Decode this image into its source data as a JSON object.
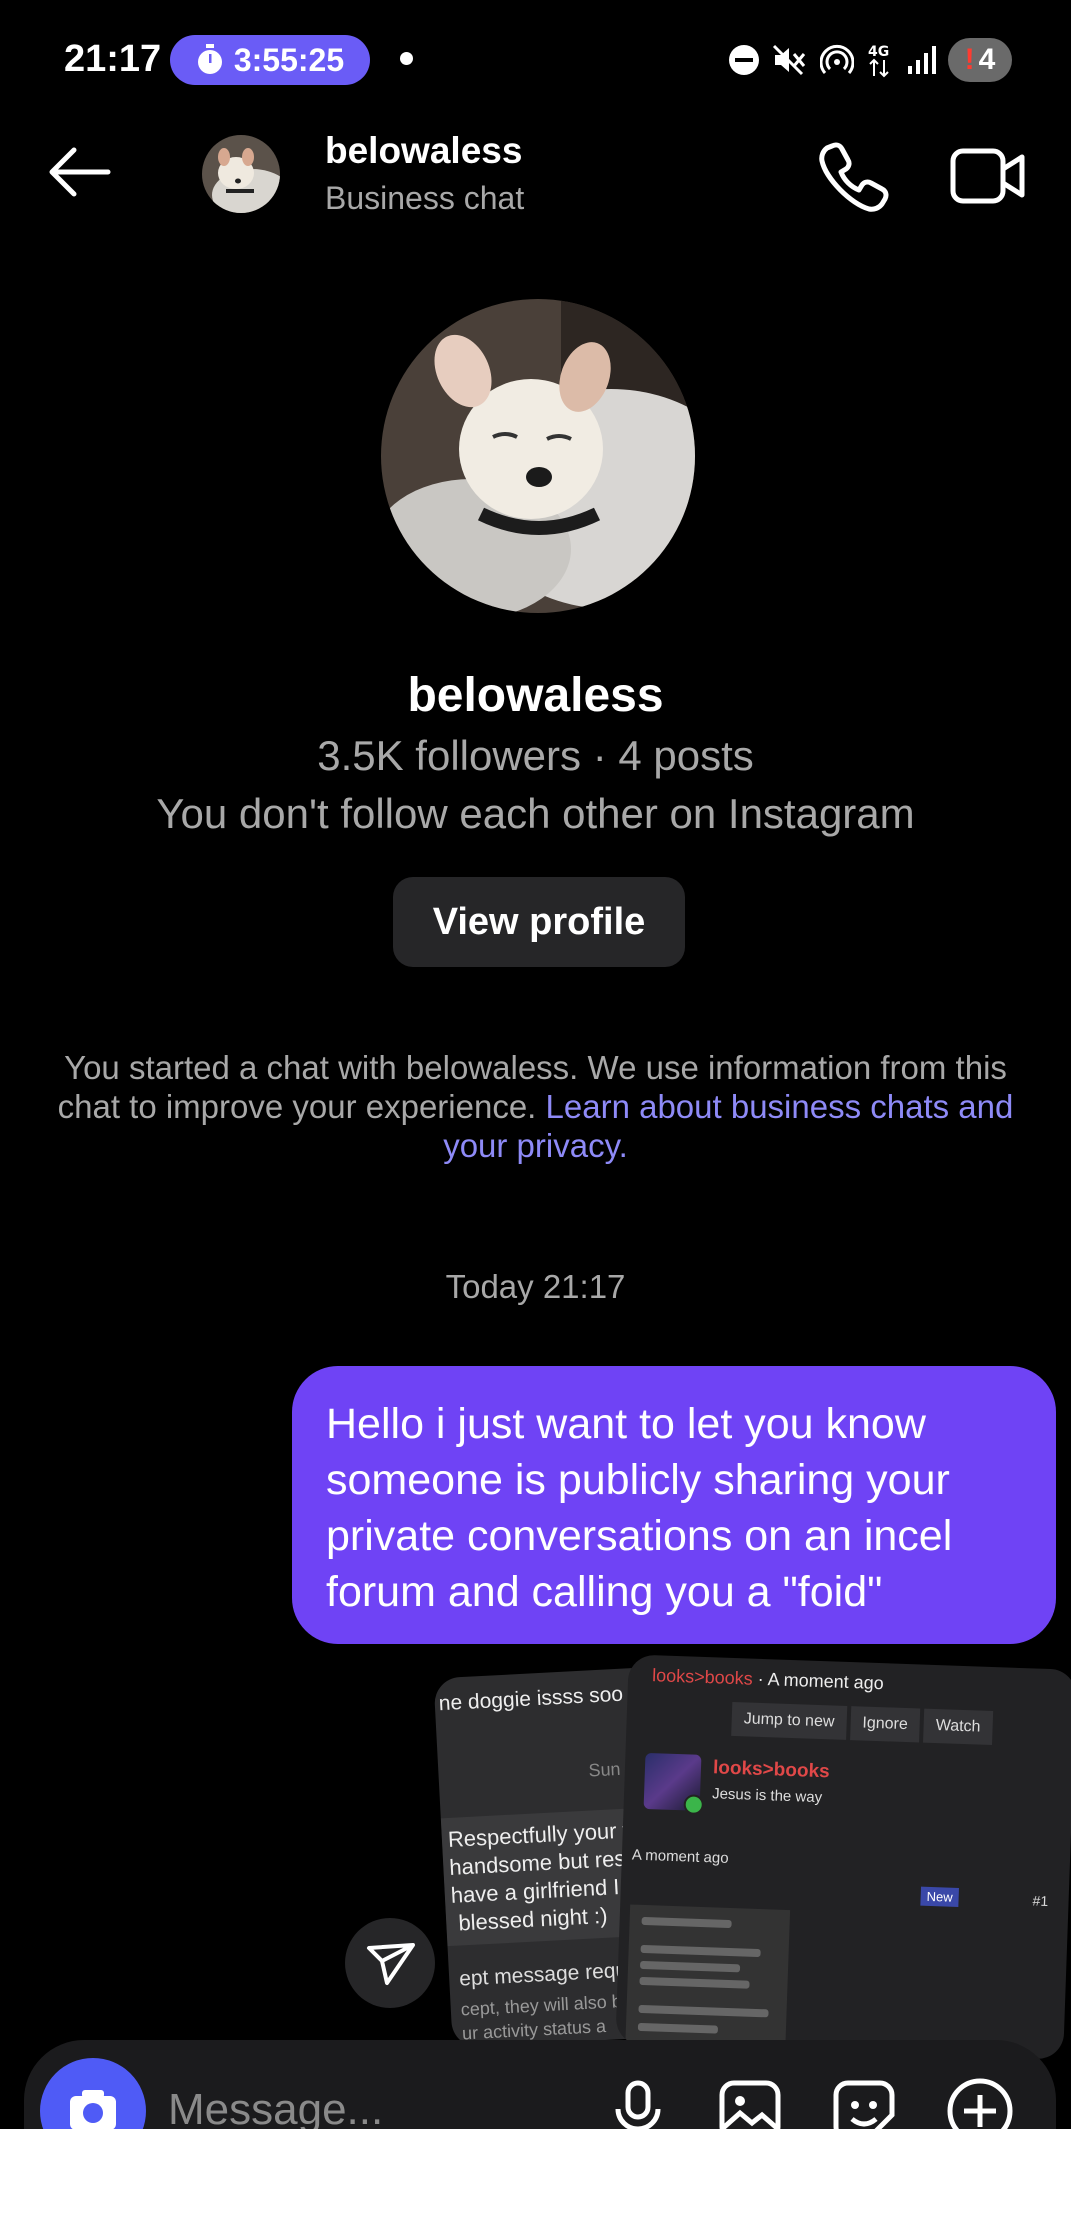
{
  "status_bar": {
    "time": "21:17",
    "timer": "3:55:25",
    "battery": "4",
    "battery_alert": "!"
  },
  "header": {
    "username": "belowaless",
    "subtitle": "Business chat"
  },
  "profile": {
    "name": "belowaless",
    "stats": "3.5K followers · 4 posts",
    "follow_status": "You don't follow each other on Instagram",
    "view_profile_label": "View profile"
  },
  "info_notice": {
    "text": "You started a chat with belowaless. We use information from this chat to improve your experience.",
    "link": "Learn about business chats and your privacy."
  },
  "conversation": {
    "date": "Today 21:17",
    "messages": [
      {
        "from": "me",
        "text": "Hello i just want to let you know someone is publicly sharing your private conversations on an incel forum and calling you a \"foid\""
      }
    ]
  },
  "shared_screenshot_left": {
    "top": "ne doggie issss soo",
    "sun": "Sun",
    "message": "Respectfully your v\nhandsome but resp\nhave a girlfriend I a\n blessed night :)",
    "request": "ept message requ",
    "sub": "cept, they will also b\nur activity status a"
  },
  "shared_screenshot_right": {
    "forum": "looks>books",
    "time": "A moment ago",
    "buttons": [
      "Jump to new",
      "Ignore",
      "Watch"
    ],
    "user": "looks>books",
    "bio": "Jesus is the way",
    "posted": "A moment ago",
    "badge": "New",
    "post_number": "#1"
  },
  "composer": {
    "placeholder": "Message..."
  },
  "colors": {
    "bubble": "#6f43f5",
    "accent": "#4f5bf6",
    "link": "#8e8af7"
  }
}
